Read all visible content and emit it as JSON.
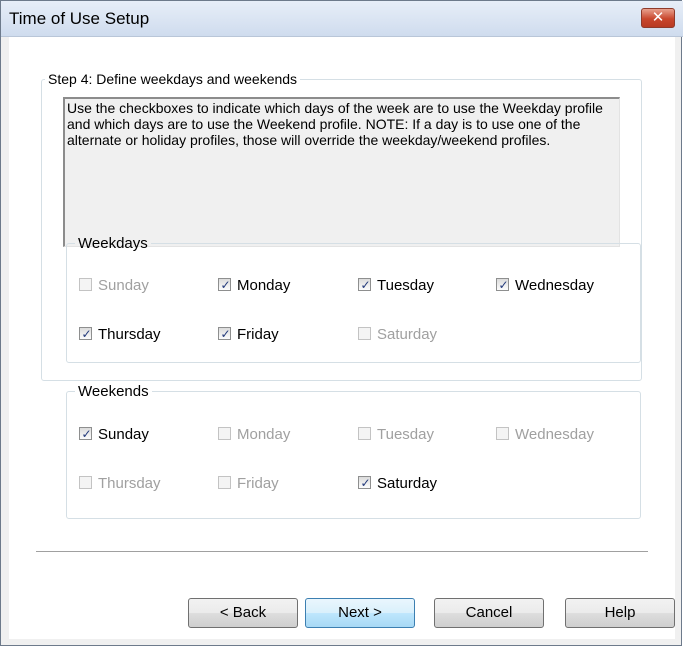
{
  "window": {
    "title": "Time of Use Setup",
    "close_glyph": "✕"
  },
  "step": {
    "legend": "Step 4: Define weekdays and weekends",
    "description": "Use the checkboxes to indicate which days of the week are to use the Weekday profile and which days are to use the Weekend profile.  NOTE: If a day is to use one of the alternate or holiday profiles, those will override the weekday/weekend profiles."
  },
  "weekdays": {
    "legend": "Weekdays",
    "days": [
      {
        "label": "Sunday",
        "checked": false,
        "enabled": false
      },
      {
        "label": "Monday",
        "checked": true,
        "enabled": true
      },
      {
        "label": "Tuesday",
        "checked": true,
        "enabled": true
      },
      {
        "label": "Wednesday",
        "checked": true,
        "enabled": true
      },
      {
        "label": "Thursday",
        "checked": true,
        "enabled": true
      },
      {
        "label": "Friday",
        "checked": true,
        "enabled": true
      },
      {
        "label": "Saturday",
        "checked": false,
        "enabled": false
      }
    ]
  },
  "weekends": {
    "legend": "Weekends",
    "days": [
      {
        "label": "Sunday",
        "checked": true,
        "enabled": true
      },
      {
        "label": "Monday",
        "checked": false,
        "enabled": false
      },
      {
        "label": "Tuesday",
        "checked": false,
        "enabled": false
      },
      {
        "label": "Wednesday",
        "checked": false,
        "enabled": false
      },
      {
        "label": "Thursday",
        "checked": false,
        "enabled": false
      },
      {
        "label": "Friday",
        "checked": false,
        "enabled": false
      },
      {
        "label": "Saturday",
        "checked": true,
        "enabled": true
      }
    ]
  },
  "buttons": {
    "back": "< Back",
    "next": "Next >",
    "cancel": "Cancel",
    "help": "Help"
  },
  "check_glyph": "✓"
}
